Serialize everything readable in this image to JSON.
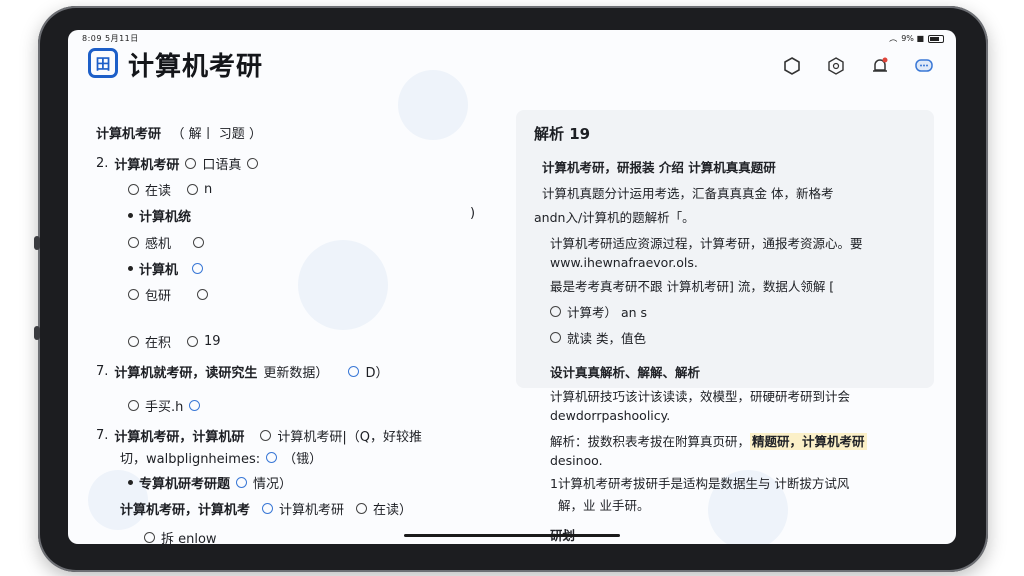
{
  "status_bar": {
    "left": "8:09 5月11日",
    "right": "9% ■"
  },
  "header": {
    "title": "计算机考研",
    "logo_glyph": "田"
  },
  "toolbar": {
    "icons": [
      "hexagon-icon",
      "settings-icon",
      "notification-icon",
      "chat-icon"
    ]
  },
  "left": {
    "heading": "计算机考研",
    "heading_sub": "（  解丨 习题    ）",
    "rows": [
      {
        "num": "2.",
        "q": "计算机考研",
        "opt1": "口语真",
        "opt2": ""
      },
      {
        "opt1": "在读",
        "opt2": "n"
      },
      {
        "bullet": "计算机统",
        "tail": ")"
      },
      {
        "opt1": "感机",
        "opt2": ""
      },
      {
        "bullet": "计算机",
        "opt2": ""
      },
      {
        "opt1": "包研",
        "opt2": ""
      },
      {
        "opt1": "在积",
        "opt2": "19"
      },
      {
        "num": "7.",
        "q": "计算机就考研，读研究生",
        "mid": "更新数据）",
        "opt2": "D）"
      },
      {
        "opt1": "手买.h",
        "opt2": ""
      },
      {
        "num": "7.",
        "q": "计算机考研，计算机研",
        "opt2": "计算机考研|（Q，好较推"
      },
      {
        "line": "切，walbplignheimes:",
        "opt2": "（锇）"
      },
      {
        "bullet": "专算机研考研题",
        "opt2": "情况）"
      },
      {
        "q": "计算机考研，计算机考",
        "opt1": "计算机考研",
        "opt2": "在读）"
      },
      {
        "opt1": "拆 enlow"
      }
    ]
  },
  "right": {
    "title": "解析 19",
    "lines": [
      "计算机考研，研报装   介绍              计算机真真题研",
      "计算机真题分计运用考选，汇备真真真金 体，新格考",
      "andn入/计算机的题解析「。",
      "计算机考研适应资源过程，计算考研，通报考资源心。要",
      "www.ihewnafraevor.ols.",
      "最是考考真考研不跟  计算机考研] 流，数据人领解 [",
      "计算考）  an s",
      "就读 类，值色",
      "设计真真解析、解解、解析",
      "计算机研技巧该计该读读，效模型，研硬研考研到计会",
      "dewdorrpashoolicy.",
      "解析：拔数积表考拔在附算真页研，",
      "desinoo.",
      "1计算机考研考拔研手是适构是数据生与 计断拔方试风",
      "解，业 业手研。",
      "研划"
    ],
    "highlight": "精题研，计算机考研"
  }
}
